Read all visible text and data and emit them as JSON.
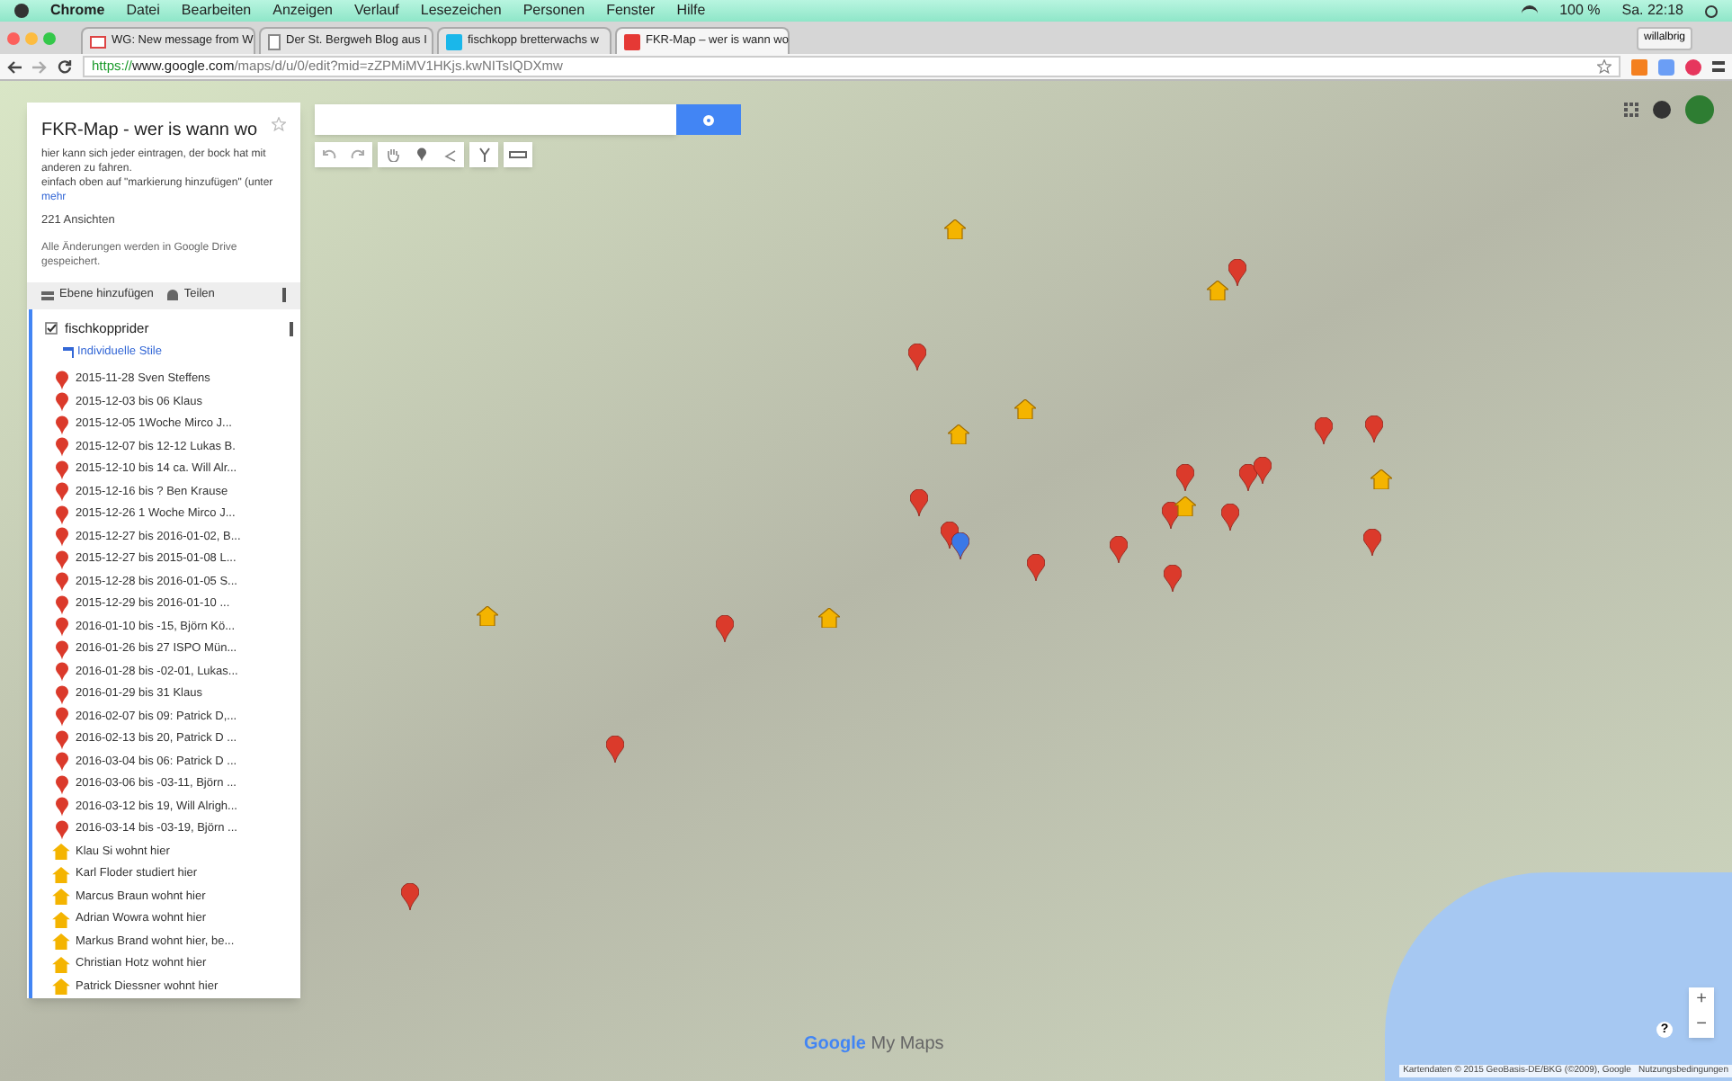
{
  "menubar": {
    "app": "Chrome",
    "menus": [
      "Datei",
      "Bearbeiten",
      "Anzeigen",
      "Verlauf",
      "Lesezeichen",
      "Personen",
      "Fenster",
      "Hilfe"
    ],
    "battery": "100 %",
    "clock": "Sa. 22:18"
  },
  "tabs": [
    {
      "title": "WG: New message from W",
      "kind": "mail",
      "selected": false
    },
    {
      "title": "Der St. Bergweh Blog aus I",
      "kind": "page",
      "selected": false
    },
    {
      "title": "fischkopp bretterwachs w",
      "kind": "v",
      "selected": false
    },
    {
      "title": "FKR-Map – wer is wann wo",
      "kind": "map",
      "selected": true
    }
  ],
  "profile": "willalbrig",
  "address": {
    "scheme": "https://",
    "host": "www.google.com",
    "path": "/maps/d/u/0/edit?mid=zZPMiMV1HKjs.kwNITsIQDXmw"
  },
  "panel": {
    "title": "FKR-Map - wer is wann wo",
    "description": "hier kann sich jeder eintragen, der bock hat mit anderen zu fahren.\neinfach oben auf \"markierung hinzufügen\" (unter",
    "more": "mehr",
    "views": "221 Ansichten",
    "saved": "Alle Änderungen werden in Google Drive gespeichert.",
    "add_layer": "Ebene hinzufügen",
    "share": "Teilen",
    "layer": {
      "name": "fischkopprider",
      "checked": true,
      "style": "Individuelle Stile",
      "items": [
        {
          "kind": "event",
          "label": "2015-11-28 Sven Steffens"
        },
        {
          "kind": "event",
          "label": "2015-12-03 bis 06 Klaus"
        },
        {
          "kind": "event",
          "label": "2015-12-05 1Woche Mirco J..."
        },
        {
          "kind": "event",
          "label": "2015-12-07 bis 12-12 Lukas B."
        },
        {
          "kind": "event",
          "label": "2015-12-10 bis 14 ca. Will Alr..."
        },
        {
          "kind": "event",
          "label": "2015-12-16 bis ? Ben Krause"
        },
        {
          "kind": "event",
          "label": "2015-12-26 1 Woche Mirco J..."
        },
        {
          "kind": "event",
          "label": "2015-12-27 bis 2016-01-02, B..."
        },
        {
          "kind": "event",
          "label": "2015-12-27 bis 2015-01-08 L..."
        },
        {
          "kind": "event",
          "label": "2015-12-28 bis 2016-01-05 S..."
        },
        {
          "kind": "event",
          "label": "2015-12-29 bis 2016-01-10 ..."
        },
        {
          "kind": "event",
          "label": "2016-01-10 bis -15, Björn Kö..."
        },
        {
          "kind": "event",
          "label": "2016-01-26 bis 27 ISPO Mün..."
        },
        {
          "kind": "event",
          "label": "2016-01-28 bis -02-01, Lukas..."
        },
        {
          "kind": "event",
          "label": "2016-01-29 bis 31 Klaus"
        },
        {
          "kind": "event",
          "label": "2016-02-07 bis 09: Patrick D,..."
        },
        {
          "kind": "event",
          "label": "2016-02-13 bis 20, Patrick D ..."
        },
        {
          "kind": "event",
          "label": "2016-03-04 bis 06: Patrick D ..."
        },
        {
          "kind": "event",
          "label": "2016-03-06 bis -03-11, Björn ..."
        },
        {
          "kind": "event",
          "label": "2016-03-12 bis 19, Will Alrigh..."
        },
        {
          "kind": "event",
          "label": "2016-03-14 bis -03-19, Björn ..."
        },
        {
          "kind": "home",
          "label": "Klau Si wohnt hier"
        },
        {
          "kind": "home",
          "label": "Karl Floder studiert hier"
        },
        {
          "kind": "home",
          "label": "Marcus Braun wohnt hier"
        },
        {
          "kind": "home",
          "label": "Adrian Wowra wohnt hier"
        },
        {
          "kind": "home",
          "label": "Markus Brand wohnt hier, be..."
        },
        {
          "kind": "home",
          "label": "Christian Hotz wohnt hier"
        },
        {
          "kind": "home",
          "label": "Patrick Diessner wohnt hier"
        }
      ]
    }
  },
  "footer": {
    "brand": "Google",
    "product": "My Maps",
    "attribution": "Kartendaten © 2015 GeoBasis-DE/BKG (©2009), Google",
    "terms": "Nutzungsbedingungen",
    "zoom_in": "+",
    "zoom_out": "−",
    "help": "?"
  }
}
